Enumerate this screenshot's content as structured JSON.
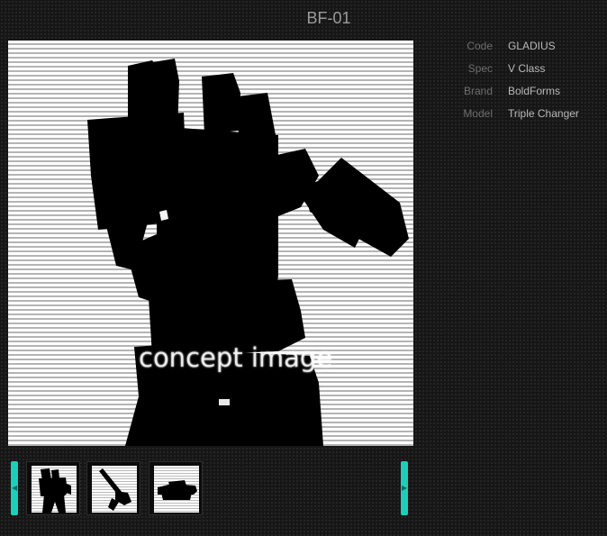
{
  "product": {
    "title": "BF-01",
    "watermark": "concept image"
  },
  "specs": [
    {
      "label": "Code",
      "value": "GLADIUS"
    },
    {
      "label": "Spec",
      "value": "V Class"
    },
    {
      "label": "Brand",
      "value": "BoldForms"
    },
    {
      "label": "Model",
      "value": "Triple Changer"
    }
  ],
  "gallery": {
    "thumbnails": [
      "robot-mode-thumbnail",
      "gun-mode-thumbnail",
      "tank-mode-thumbnail"
    ],
    "prev_icon": "chevron-left-icon",
    "next_icon": "chevron-right-icon"
  },
  "colors": {
    "accent": "#1ecfb8",
    "background": "#161616",
    "title": "#9a9a9a",
    "label": "#6d6d6d",
    "value": "#b9b9b9"
  }
}
